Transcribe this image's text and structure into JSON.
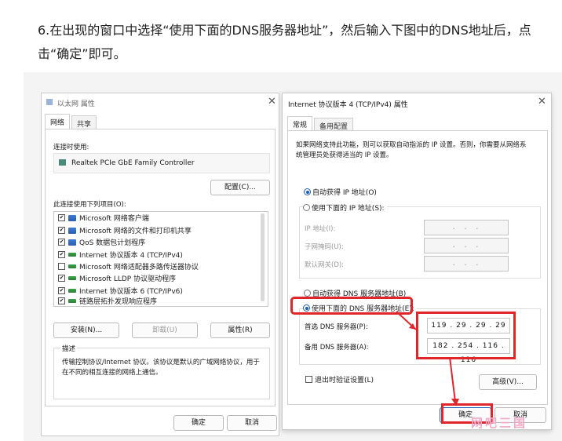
{
  "article": {
    "step_text": "6.在出现的窗口中选择“使用下面的DNS服务器地址”，然后输入下图中的DNS地址后，点击“确定”即可。"
  },
  "eth_dialog": {
    "title": "以太网 属性",
    "tabs": [
      "网络",
      "共享"
    ],
    "connect_using_label": "连接时使用:",
    "adapter_name": "Realtek PCIe GbE Family Controller",
    "configure_button": "配置(C)...",
    "items_label": "此连接使用下列项目(O):",
    "items": [
      {
        "label": "Microsoft 网络客户端",
        "checked": true
      },
      {
        "label": "Microsoft 网络的文件和打印机共享",
        "checked": true
      },
      {
        "label": "QoS 数据包计划程序",
        "checked": true
      },
      {
        "label": "Internet 协议版本 4 (TCP/IPv4)",
        "checked": true
      },
      {
        "label": "Microsoft 网络适配器多路传送器协议",
        "checked": false
      },
      {
        "label": "Microsoft LLDP 协议驱动程序",
        "checked": true
      },
      {
        "label": "Internet 协议版本 6 (TCP/IPv6)",
        "checked": true
      },
      {
        "label": "链路层拓扑发现响应程序",
        "checked": true
      }
    ],
    "install_button": "安装(N)...",
    "uninstall_button": "卸载(U)",
    "properties_button": "属性(R)",
    "description_label": "描述",
    "description_text": "传输控制协议/Internet 协议。该协议是默认的广域网络协议，用于在不同的相互连接的网络上通信。",
    "ok_button": "确定",
    "cancel_button": "取消"
  },
  "ipv4_dialog": {
    "title": "Internet 协议版本 4 (TCP/IPv4) 属性",
    "tabs": [
      "常规",
      "备用配置"
    ],
    "intro_text": "如果网络支持此功能，则可以获取自动指派的 IP 设置。否则，你需要从网络系统管理员处获得适当的 IP 设置。",
    "auto_ip_label": "自动获得 IP 地址(O)",
    "manual_ip_label": "使用下面的 IP 地址(S):",
    "ip_address_label": "IP 地址(I):",
    "subnet_mask_label": "子网掩码(U):",
    "gateway_label": "默认网关(D):",
    "empty_ip": ".   .   .",
    "auto_dns_label": "自动获得 DNS 服务器地址(B)",
    "manual_dns_label": "使用下面的 DNS 服务器地址(E):",
    "preferred_dns_label": "首选 DNS 服务器(P):",
    "alternate_dns_label": "备用 DNS 服务器(A):",
    "preferred_dns": "119 . 29 . 29 . 29",
    "alternate_dns": "182 . 254 . 116 . 116",
    "validate_label": "退出时验证设置(L)",
    "advanced_button": "高级(V)...",
    "ok_button": "确定",
    "cancel_button": "取消"
  },
  "watermark": {
    "text": "网吧三国"
  },
  "colors": {
    "highlight_red": "#e0262b",
    "radio_blue": "#1a5fb4"
  }
}
